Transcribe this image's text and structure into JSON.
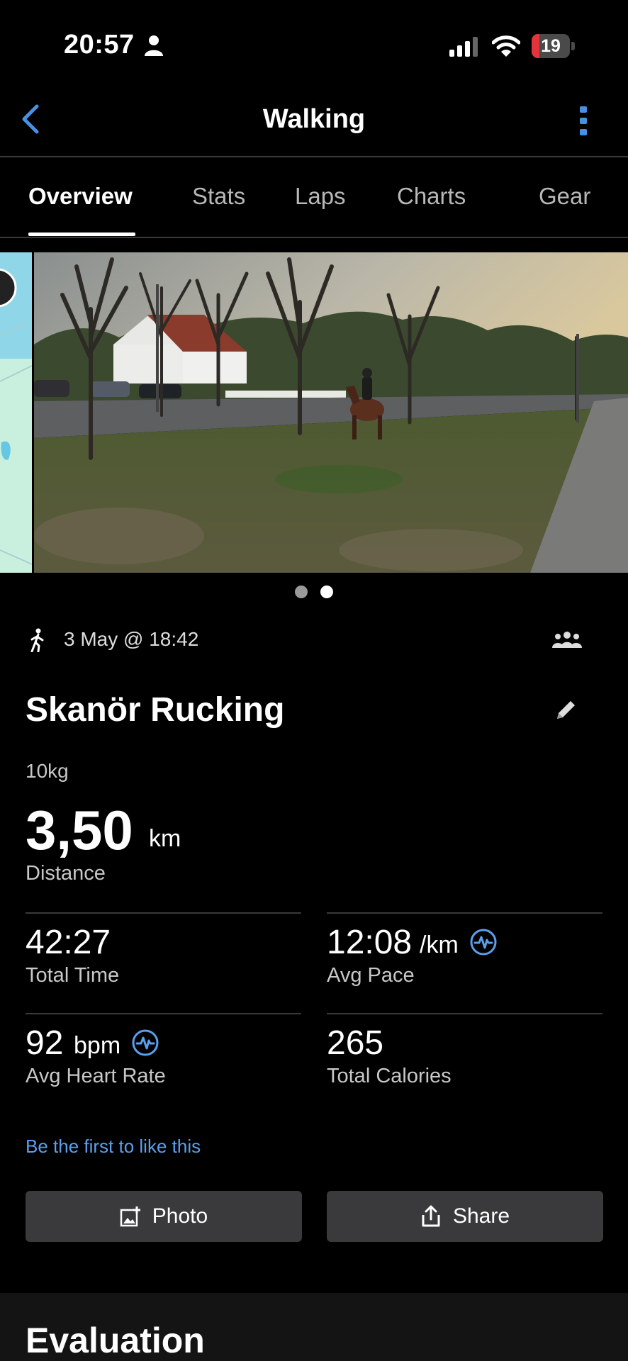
{
  "status_bar": {
    "time": "20:57",
    "battery": "19",
    "icons": [
      "person-icon",
      "signal-icon",
      "wifi-icon",
      "battery-icon"
    ]
  },
  "nav": {
    "title": "Walking",
    "back_icon": "chevron-left-icon",
    "more_icon": "more-vertical-icon"
  },
  "tabs": [
    {
      "label": "Overview",
      "active": true
    },
    {
      "label": "Stats",
      "active": false
    },
    {
      "label": "Laps",
      "active": false
    },
    {
      "label": "Charts",
      "active": false
    },
    {
      "label": "Gear",
      "active": false
    }
  ],
  "carousel": {
    "slides": [
      "map",
      "photo"
    ],
    "active_index": 1,
    "colors": {
      "dot_active": "#ffffff",
      "dot_inactive": "#9a9a9a"
    }
  },
  "activity": {
    "date": "3 May @ 18:42",
    "title": "Skanör Rucking",
    "note": "10kg",
    "distance": {
      "value": "3,50",
      "unit": "km",
      "label": "Distance"
    }
  },
  "stats": {
    "total_time": {
      "value": "42:27",
      "label": "Total Time"
    },
    "avg_pace": {
      "value": "12:08",
      "unit": "/km",
      "label": "Avg Pace"
    },
    "avg_heart_rate": {
      "value": "92",
      "unit": "bpm",
      "label": "Avg Heart Rate"
    },
    "total_calories": {
      "value": "265",
      "label": "Total Calories"
    }
  },
  "social": {
    "like_text": "Be the first to like this"
  },
  "actions": {
    "photo_label": "Photo",
    "share_label": "Share"
  },
  "evaluation": {
    "title": "Evaluation"
  },
  "colors": {
    "accent": "#5aa0ec",
    "background": "#000000",
    "button": "#3a3a3c",
    "battery_low": "#e5333b"
  }
}
